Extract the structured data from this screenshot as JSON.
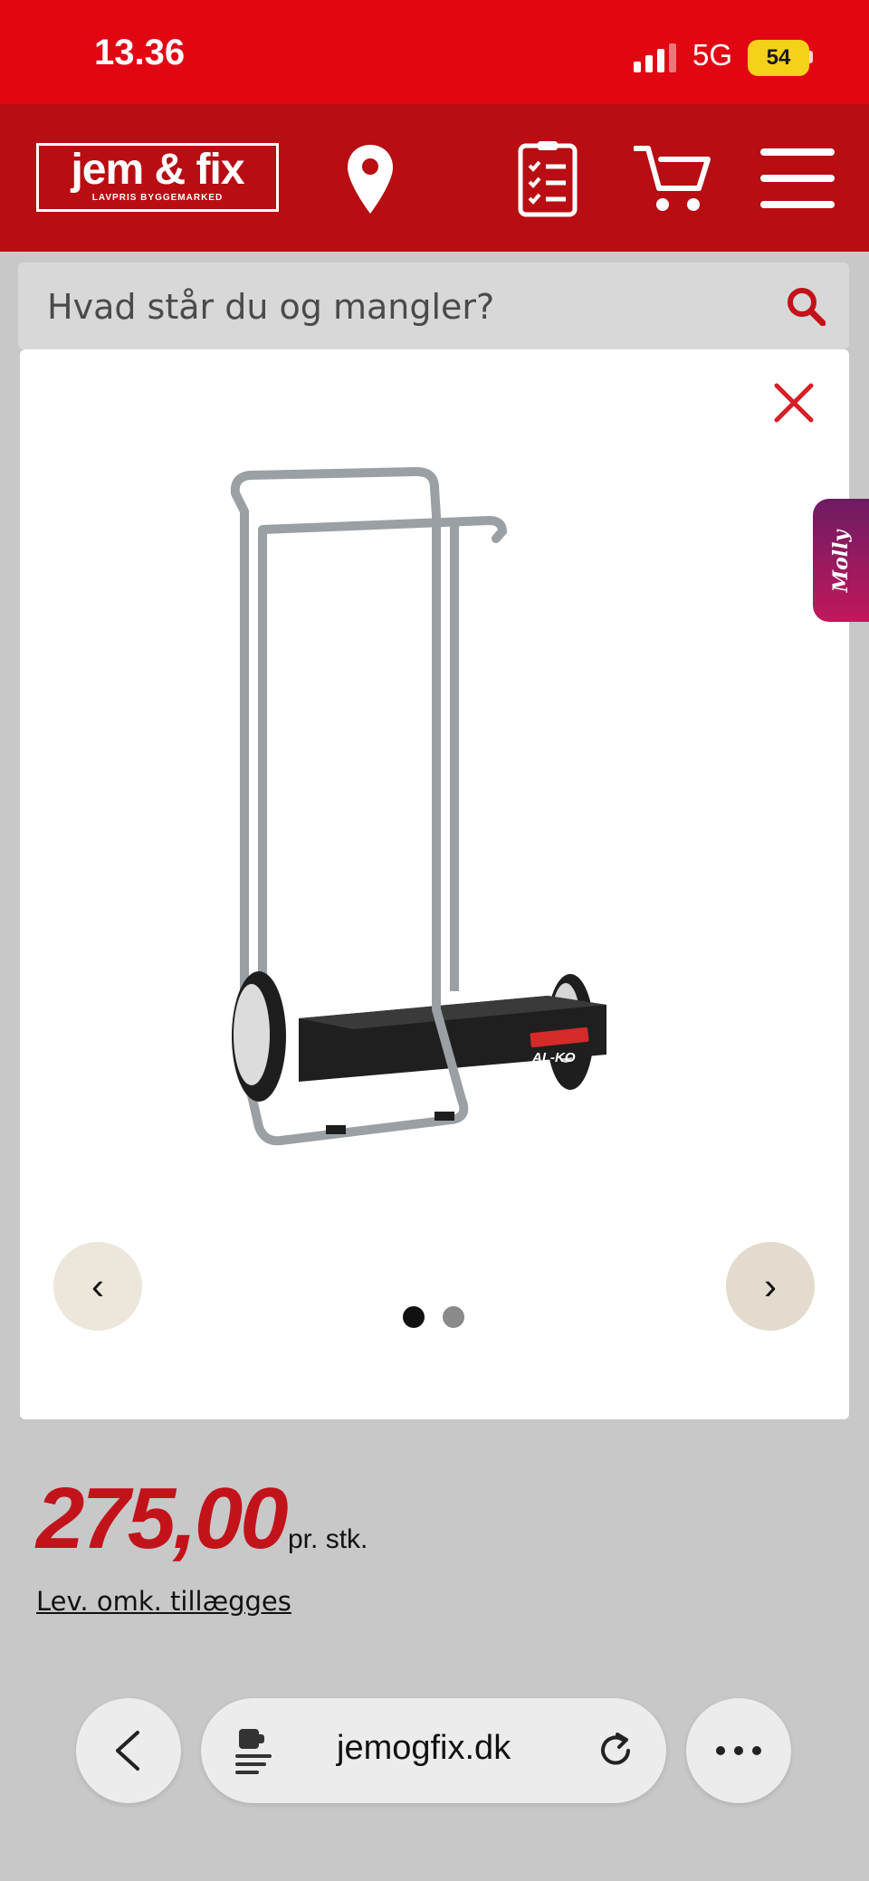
{
  "status_bar": {
    "time": "13.36",
    "network": "5G",
    "battery": "54"
  },
  "header": {
    "logo_name": "jem & fix",
    "logo_tagline": "LAVPRIS BYGGEMARKED",
    "icons": [
      "location-pin-icon",
      "shopping-list-icon",
      "cart-icon",
      "menu-icon"
    ]
  },
  "search": {
    "placeholder": "Hvad står du og mangler?"
  },
  "gallery": {
    "prev_label": "‹",
    "next_label": "›",
    "image_count": 2,
    "active_index": 1,
    "brand_on_product": "AL-KO"
  },
  "chat_widget": {
    "label": "Molly"
  },
  "product": {
    "price": "275,00",
    "unit": "pr. stk.",
    "delivery_note": "Lev. omk. tillægges"
  },
  "browser": {
    "url": "jemogfix.dk"
  },
  "colors": {
    "brand_red": "#e20613",
    "header_red": "#b70d13",
    "price_red": "#c2131b"
  }
}
